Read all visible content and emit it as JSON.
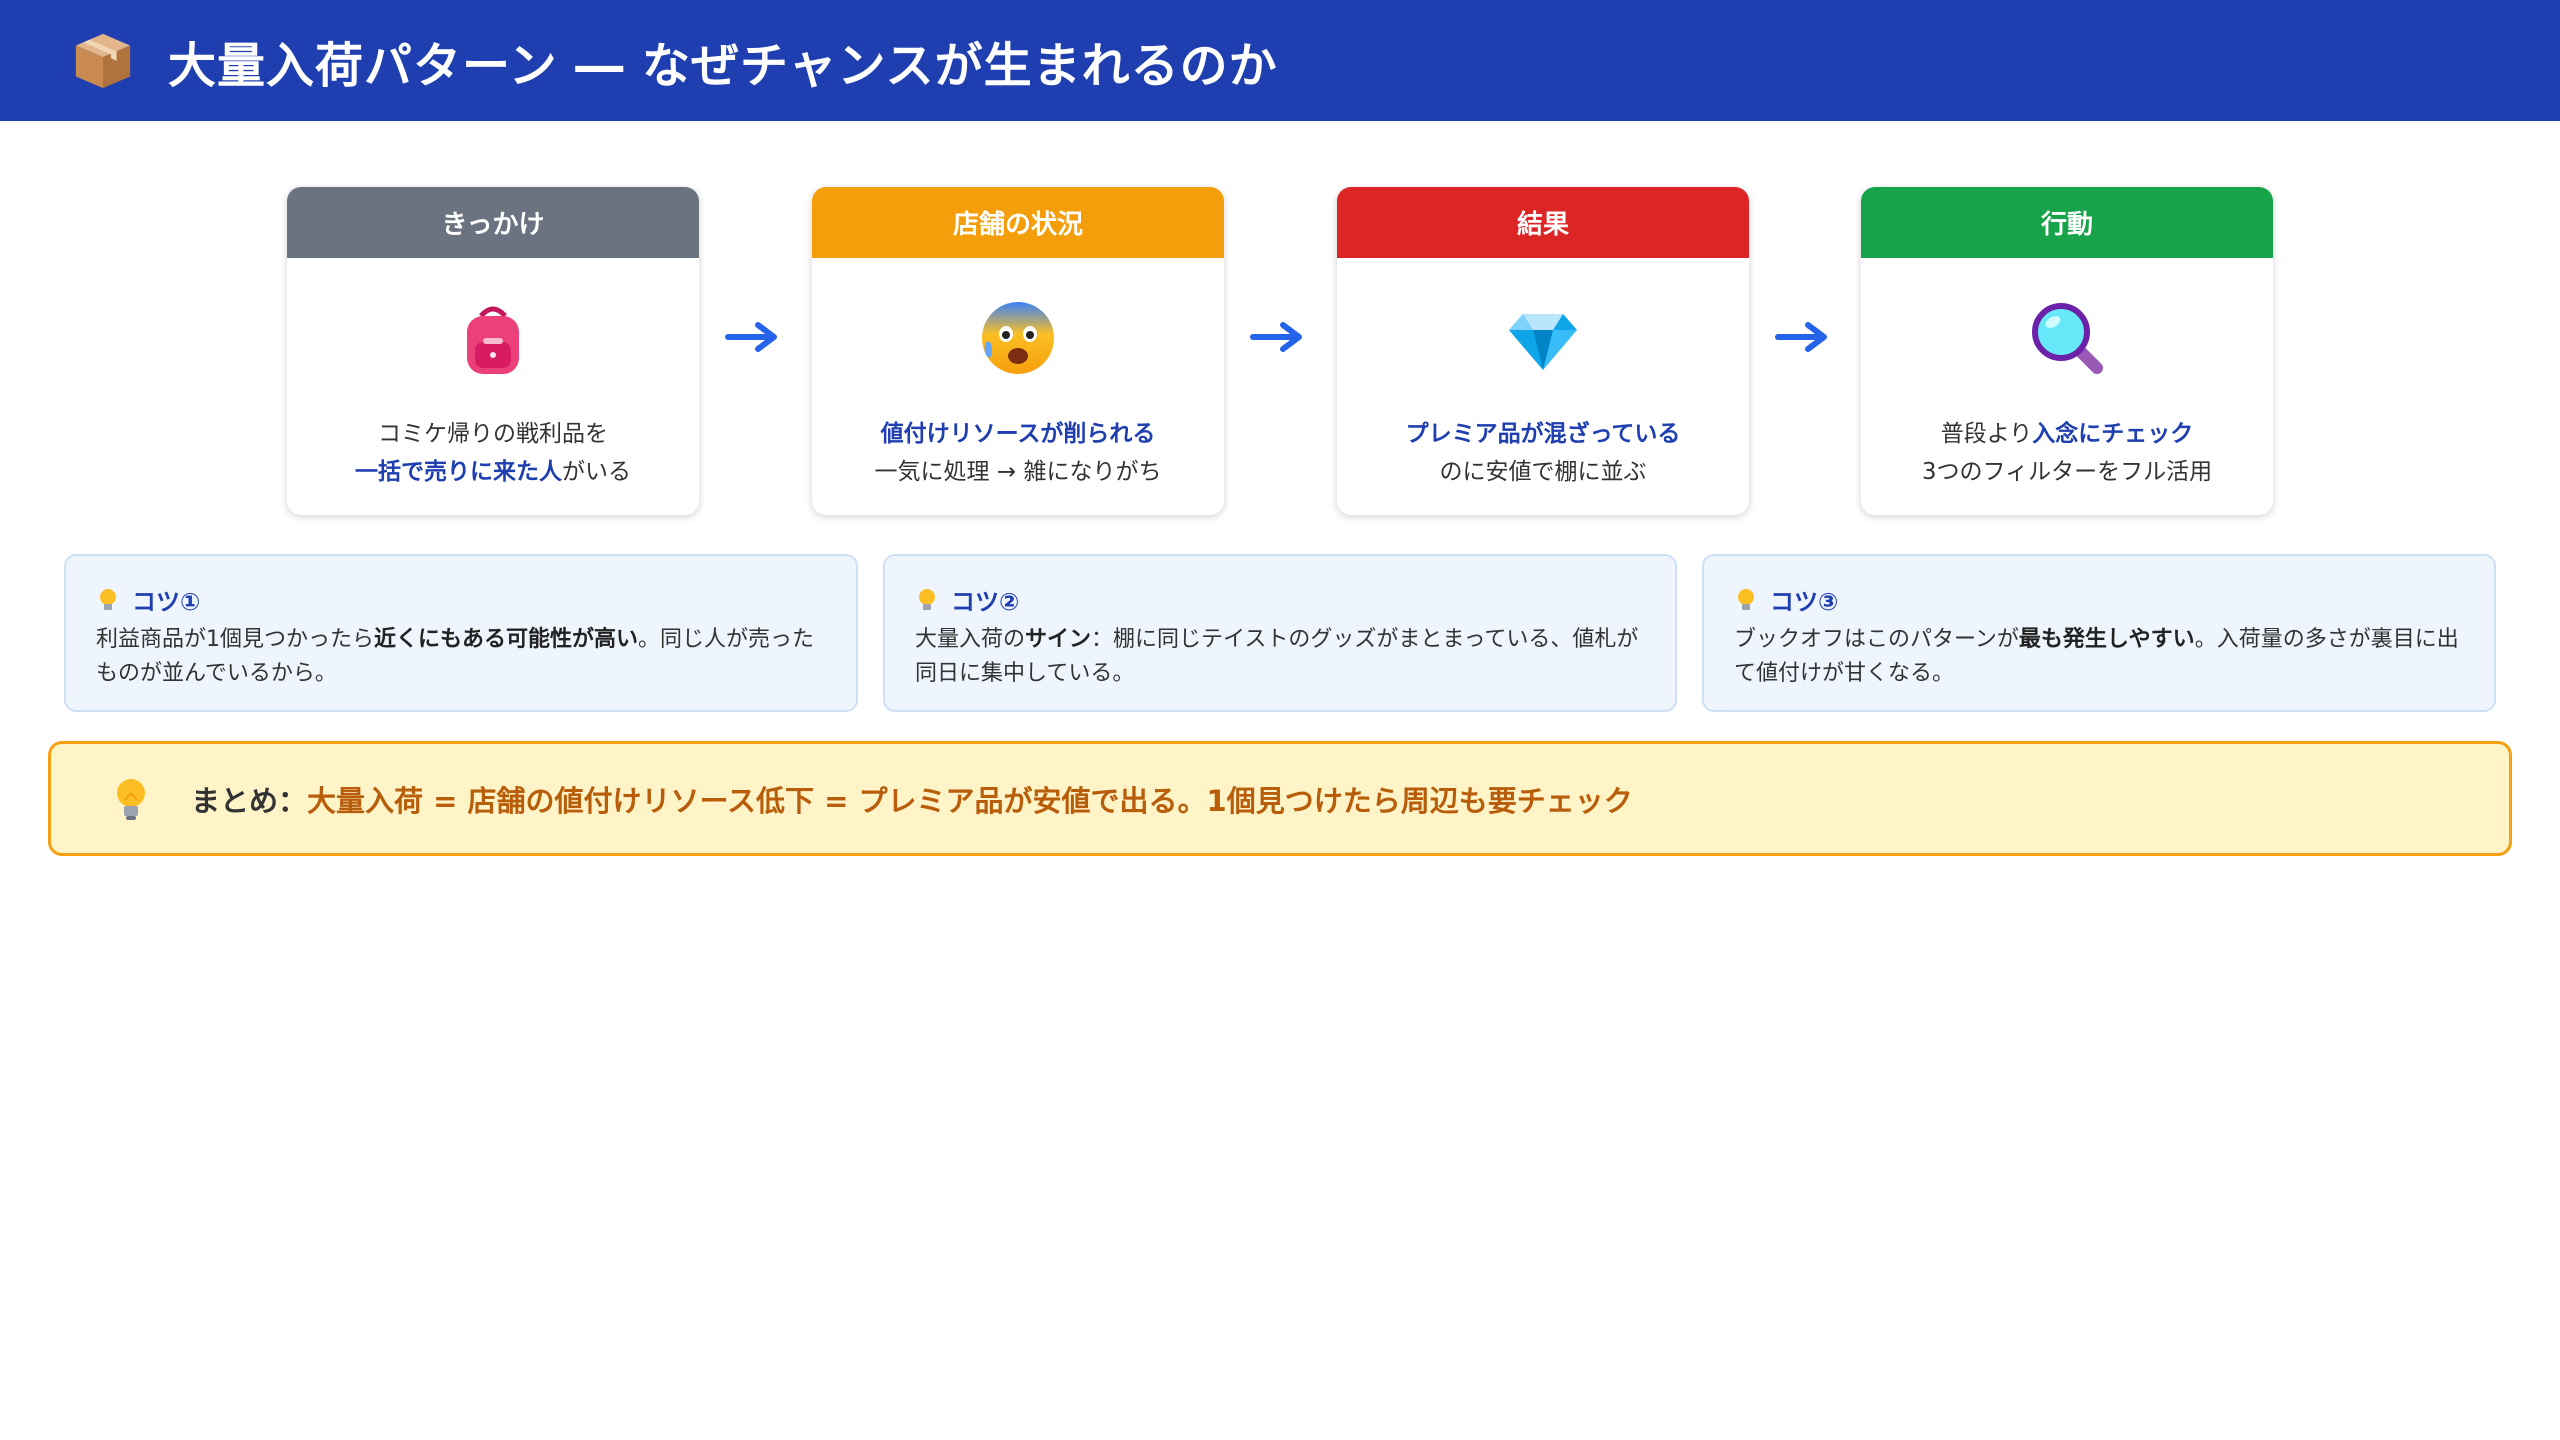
{
  "header": {
    "title": "大量入荷パターン ― なぜチャンスが生まれるのか",
    "icon": "package-box-icon",
    "background": "#1f3fb0"
  },
  "flow": [
    {
      "title": "きっかけ",
      "color": "#6b7280",
      "icon": "backpack-icon",
      "line1": {
        "pre": "コミケ帰りの戦利品を",
        "hl": "",
        "post": ""
      },
      "line2": {
        "pre": "",
        "hl": "一括で売りに来た人",
        "post": "がいる"
      }
    },
    {
      "title": "店舗の状況",
      "color": "#f59e0b",
      "icon": "anxious-face-icon",
      "line1": {
        "pre": "",
        "hl": "値付けリソースが削られる",
        "post": ""
      },
      "line2": {
        "pre": "一気に処理 → 雑になりがち",
        "hl": "",
        "post": ""
      }
    },
    {
      "title": "結果",
      "color": "#dc2626",
      "icon": "gem-icon",
      "line1": {
        "pre": "",
        "hl": "プレミア品が混ざっている",
        "post": ""
      },
      "line2": {
        "pre": "のに安値で棚に並ぶ",
        "hl": "",
        "post": ""
      }
    },
    {
      "title": "行動",
      "color": "#16a34a",
      "icon": "magnifying-glass-icon",
      "line1": {
        "pre": "普段より",
        "hl": "入念にチェック",
        "post": ""
      },
      "line2": {
        "pre": "3つのフィルターをフル活用",
        "hl": "",
        "post": ""
      }
    }
  ],
  "tips": [
    {
      "title": "コツ①",
      "pre": "利益商品が1個見つかったら",
      "bold": "近くにもある可能性が高い",
      "post": "。同じ人が売ったものが並んでいるから。"
    },
    {
      "title": "コツ②",
      "pre": "大量入荷の",
      "bold": "サイン",
      "post": "：棚に同じテイストのグッズがまとまっている、値札が同日に集中している。"
    },
    {
      "title": "コツ③",
      "pre": "ブックオフはこのパターンが",
      "bold": "最も発生しやすい",
      "post": "。入荷量の多さが裏目に出て値付けが甘くなる。"
    }
  ],
  "summary": {
    "icon": "light-bulb-icon",
    "label": "まとめ：",
    "text": "大量入荷 = 店舗の値付けリソース低下 = プレミア品が安値で出る。1個見つけたら周辺も要チェック"
  }
}
